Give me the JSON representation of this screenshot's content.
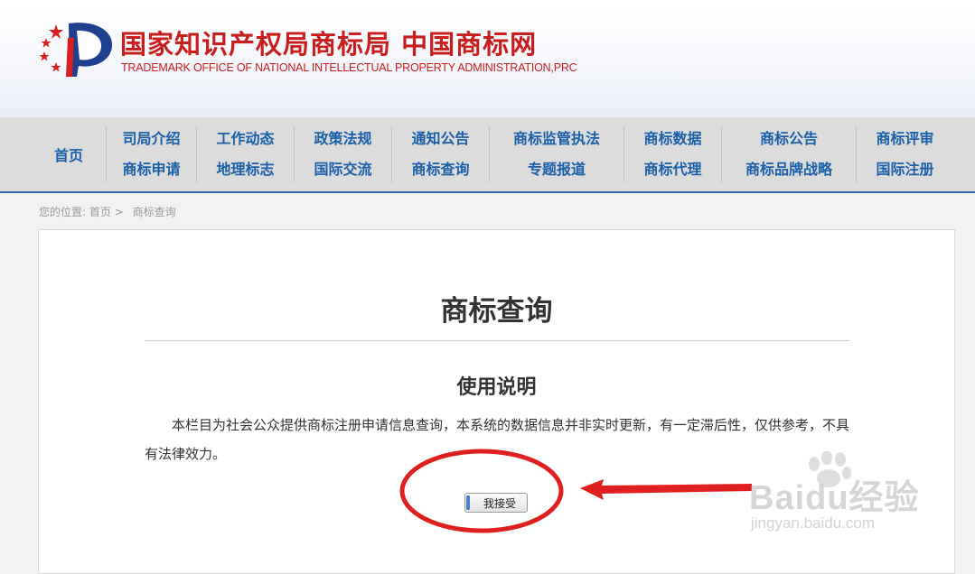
{
  "header": {
    "title": "国家知识产权局商标局 中国商标网",
    "subtitle": "TRADEMARK OFFICE OF NATIONAL INTELLECTUAL PROPERTY ADMINISTRATION,PRC"
  },
  "nav": {
    "home": "首页",
    "columns": [
      {
        "top": "司局介绍",
        "bottom": "商标申请"
      },
      {
        "top": "工作动态",
        "bottom": "地理标志"
      },
      {
        "top": "政策法规",
        "bottom": "国际交流"
      },
      {
        "top": "通知公告",
        "bottom": "商标查询"
      },
      {
        "top": "商标监管执法",
        "bottom": "专题报道"
      },
      {
        "top": "商标数据",
        "bottom": "商标代理"
      },
      {
        "top": "商标公告",
        "bottom": "商标品牌战略"
      },
      {
        "top": "商标评审",
        "bottom": "国际注册"
      }
    ]
  },
  "breadcrumb": {
    "prefix": "您的位置:",
    "home": "首页",
    "separator": ">",
    "current": "商标查询"
  },
  "content": {
    "title": "商标查询",
    "section_title": "使用说明",
    "notice": "本栏目为社会公众提供商标注册申请信息查询，本系统的数据信息并非实时更新，有一定滞后性，仅供参考，不具有法律效力。",
    "accept_button": "我接受"
  },
  "watermark": {
    "brand": "Baidu经验",
    "url": "jingyan.baidu.com"
  },
  "colors": {
    "brand_red": "#c81e1e",
    "nav_link": "#1a5fa8",
    "nav_bg": "#dcdcdc",
    "annotation_red": "#e02020"
  }
}
